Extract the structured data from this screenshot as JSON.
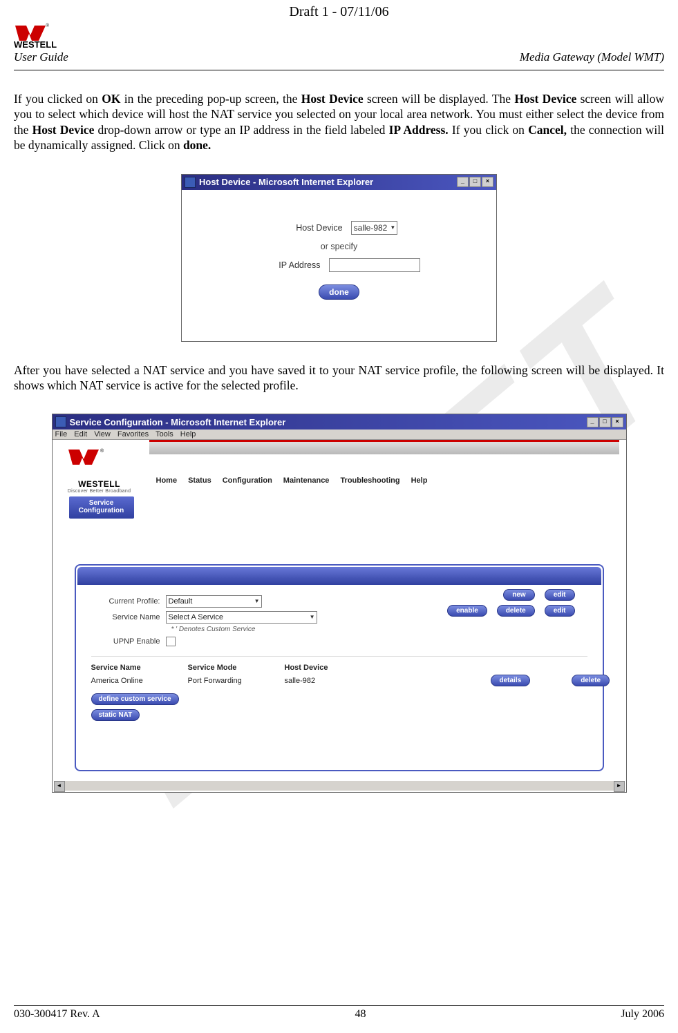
{
  "header": {
    "draft": "Draft 1 - 07/11/06",
    "brand": "WESTELL",
    "userGuide": "User Guide",
    "model": "Media Gateway (Model WMT)"
  },
  "paragraph1": {
    "s1a": "If you clicked on ",
    "s1b": "OK",
    "s1c": " in the preceding pop-up screen, the ",
    "s1d": "Host Device",
    "s1e": " screen will be displayed. The ",
    "s1f": "Host Device",
    "s1g": " screen will allow you to select which device will host the NAT service you selected on your local area network. You must either select the device from the ",
    "s1h": "Host Device",
    "s1i": " drop-down arrow or type an IP address in the field labeled ",
    "s1j": "IP Address.",
    "s1k": " If you click on ",
    "s1l": "Cancel,",
    "s1m": " the connection will be dynamically assigned. Click on ",
    "s1n": "done."
  },
  "fig1": {
    "title": "Host Device - Microsoft Internet Explorer",
    "hostDeviceLabel": "Host Device",
    "hostDeviceValue": "salle-982",
    "orSpecify": "or specify",
    "ipAddressLabel": "IP Address",
    "doneBtn": "done"
  },
  "paragraph2": "After you have selected a NAT service and you have saved it to your NAT service profile, the following screen will be displayed. It shows which NAT service is active for the selected profile.",
  "fig2": {
    "title": "Service Configuration - Microsoft Internet Explorer",
    "menu": {
      "file": "File",
      "edit": "Edit",
      "view": "View",
      "favorites": "Favorites",
      "tools": "Tools",
      "help": "Help"
    },
    "brand": "WESTELL",
    "tagline": "Discover Better Broadband",
    "sidebarBtn_l1": "Service",
    "sidebarBtn_l2": "Configuration",
    "nav": {
      "home": "Home",
      "status": "Status",
      "configuration": "Configuration",
      "maintenance": "Maintenance",
      "troubleshooting": "Troubleshooting",
      "help": "Help"
    },
    "labels": {
      "currentProfile": "Current Profile:",
      "serviceName": "Service Name",
      "upnp": "UPNP Enable"
    },
    "values": {
      "currentProfile": "Default",
      "serviceName": "Select A Service",
      "customNote": "*  ' Denotes Custom Service"
    },
    "buttons": {
      "new": "new",
      "editTop": "edit",
      "enable": "enable",
      "delete": "delete",
      "editMid": "edit",
      "details": "details",
      "deleteRow": "delete",
      "defineCustom": "define custom service",
      "staticNat": "static NAT"
    },
    "table": {
      "hServiceName": "Service Name",
      "hServiceMode": "Service Mode",
      "hHostDevice": "Host Device",
      "rServiceName": "America Online",
      "rServiceMode": "Port Forwarding",
      "rHostDevice": "salle-982"
    }
  },
  "footer": {
    "rev": "030-300417 Rev. A",
    "page": "48",
    "date": "July 2006"
  },
  "watermark": "DRAFT"
}
